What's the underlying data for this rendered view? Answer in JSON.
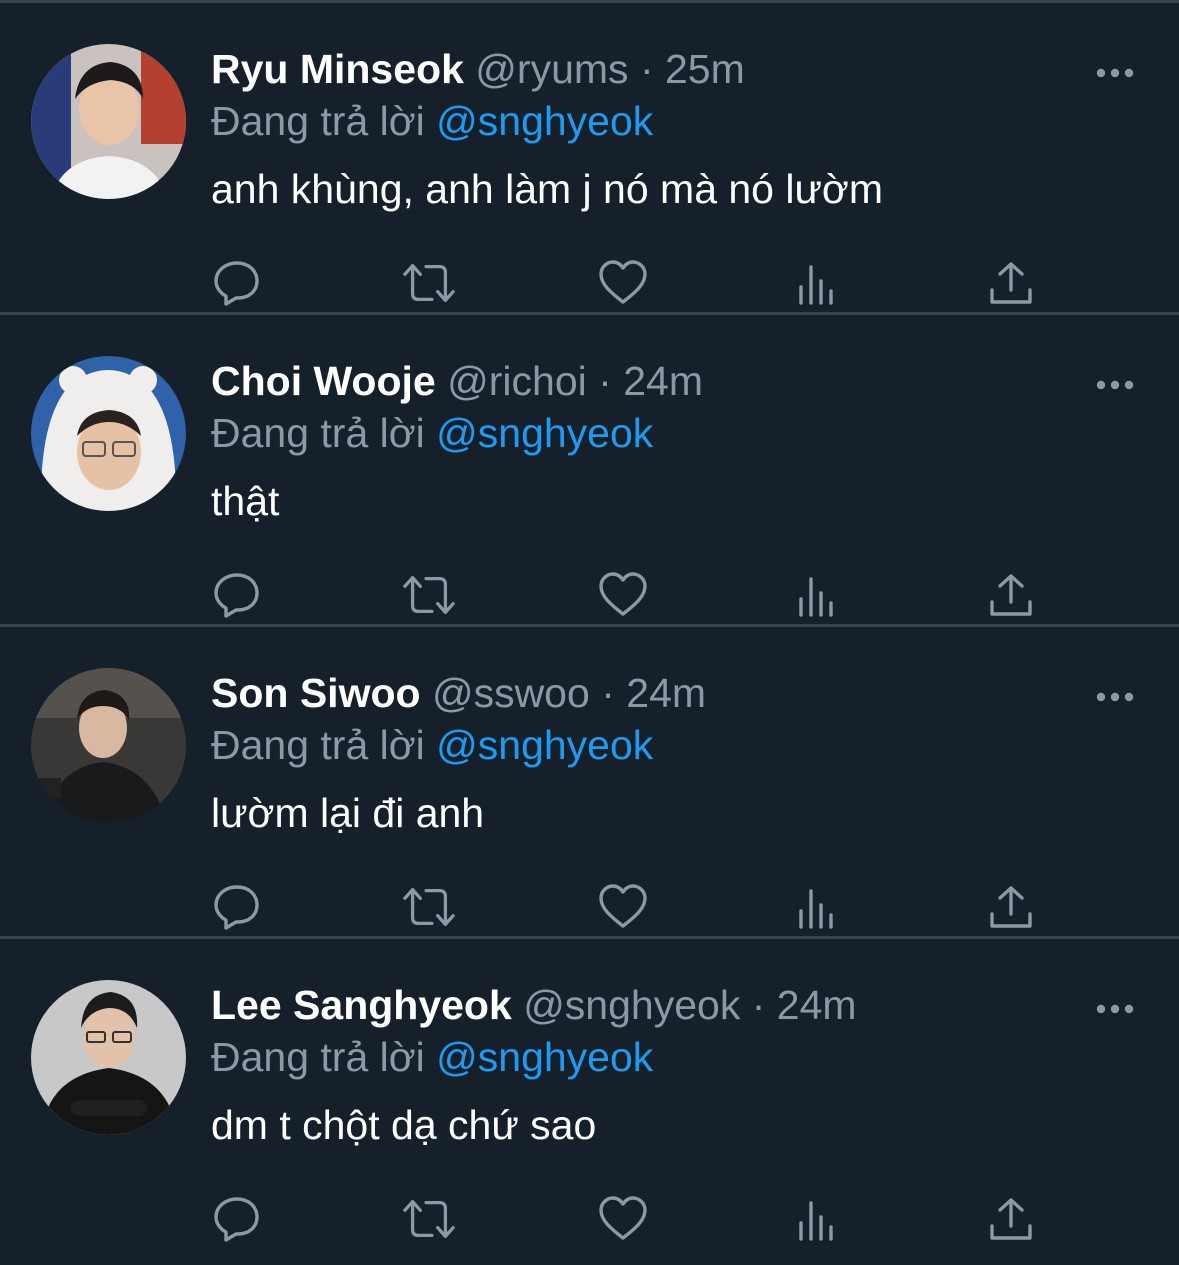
{
  "reply_prefix": "Đang trả lời",
  "colors": {
    "background": "#15202b",
    "divider": "#38444d",
    "muted_text": "#8b98a5",
    "mention": "#1d9bf0",
    "primary_text": "#ffffff"
  },
  "icons": {
    "more": "more-horizontal-icon",
    "reply": "reply-icon",
    "retweet": "retweet-icon",
    "like": "like-icon",
    "views": "views-icon",
    "share": "share-icon"
  },
  "tweets": [
    {
      "name": "Ryu Minseok",
      "handle": "@ryums",
      "separator": "·",
      "time": "25m",
      "reply_to": "@snghyeok",
      "text": "anh khùng, anh làm j nó mà nó lườm"
    },
    {
      "name": "Choi Wooje",
      "handle": "@richoi",
      "separator": "·",
      "time": "24m",
      "reply_to": "@snghyeok",
      "text": "thật"
    },
    {
      "name": "Son Siwoo",
      "handle": "@sswoo",
      "separator": "·",
      "time": "24m",
      "reply_to": "@snghyeok",
      "text": "lườm lại đi anh"
    },
    {
      "name": "Lee Sanghyeok",
      "handle": "@snghyeok",
      "separator": "·",
      "time": "24m",
      "reply_to": "@snghyeok",
      "text": "dm t chột dạ chứ sao"
    }
  ]
}
